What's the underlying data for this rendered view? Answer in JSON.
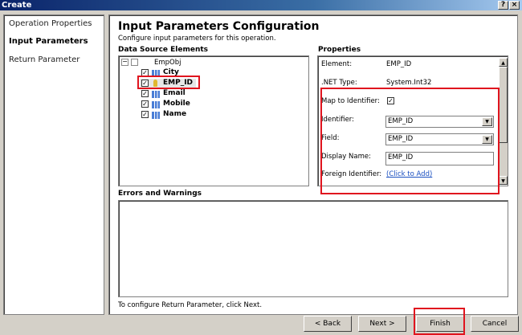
{
  "window": {
    "title": "Create",
    "help": "?",
    "close": "×"
  },
  "nav": {
    "items": [
      {
        "label": "Operation Properties"
      },
      {
        "label": "Input Parameters"
      },
      {
        "label": "Return Parameter"
      }
    ]
  },
  "main": {
    "title": "Input Parameters Configuration",
    "subtitle": "Configure input parameters for this operation.",
    "data_source_label": "Data Source Elements",
    "tree": {
      "root": "EmpObj",
      "expander": "−",
      "children": [
        {
          "label": "City",
          "checked": true
        },
        {
          "label": "EMP_ID",
          "checked": true
        },
        {
          "label": "Email",
          "checked": true
        },
        {
          "label": "Mobile",
          "checked": true
        },
        {
          "label": "Name",
          "checked": true
        }
      ]
    },
    "properties_label": "Properties",
    "properties": {
      "element_label": "Element:",
      "element_value": "EMP_ID",
      "type_label": ".NET Type:",
      "type_value": "System.Int32",
      "map_label": "Map to Identifier:",
      "identifier_label": "Identifier:",
      "identifier_value": "EMP_ID",
      "field_label": "Field:",
      "field_value": "EMP_ID",
      "display_label": "Display Name:",
      "display_value": "EMP_ID",
      "foreign_label": "Foreign Identifier:",
      "foreign_link": "(Click to Add)"
    },
    "errors_label": "Errors and Warnings",
    "footer_text": "To configure Return Parameter, click Next."
  },
  "buttons": {
    "back": "< Back",
    "next": "Next >",
    "finish": "Finish",
    "cancel": "Cancel"
  },
  "glyphs": {
    "check": "✓",
    "up": "▲",
    "down": "▼"
  }
}
